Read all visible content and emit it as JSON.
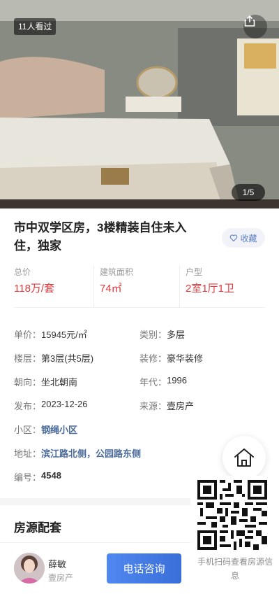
{
  "photo": {
    "viewed_badge": "11人看过",
    "counter": "1/5"
  },
  "listing": {
    "title": "市中双学区房，3楼精装自住未入住，独家",
    "favorite_label": "收藏"
  },
  "stats": [
    {
      "label": "总价",
      "value": "118万/套"
    },
    {
      "label": "建筑面积",
      "value": "74㎡"
    },
    {
      "label": "户型",
      "value": "2室1厅1卫"
    }
  ],
  "details": {
    "unit_price": {
      "key": "单价：",
      "value": "15945元/㎡"
    },
    "category": {
      "key": "类别：",
      "value": "多层"
    },
    "floor": {
      "key": "楼层：",
      "value": "第3层(共5层)"
    },
    "decoration": {
      "key": "装修：",
      "value": "豪华装修"
    },
    "orientation": {
      "key": "朝向：",
      "value": "坐北朝南"
    },
    "year": {
      "key": "年代：",
      "value": "1996"
    },
    "published": {
      "key": "发布：",
      "value": "2023-12-26"
    },
    "source": {
      "key": "来源：",
      "value": "壹房产"
    },
    "community": {
      "key": "小区：",
      "value": "钢绳小区"
    },
    "address": {
      "key": "地址：",
      "value": "滨江路北侧，公园路东侧"
    },
    "code": {
      "key": "编号：",
      "value": "4548"
    }
  },
  "facilities": {
    "title": "房源配套"
  },
  "qr": {
    "caption": "手机扫码查看房源信息"
  },
  "agent": {
    "name": "薛敏",
    "company": "壹房产",
    "call_label": "电话咨询"
  },
  "colors": {
    "price_red": "#e4393c",
    "link_blue": "#4a6b9a",
    "button_blue": "#3a6fd8"
  },
  "icons": {
    "share": "share-icon",
    "favorite": "heart-icon",
    "home": "home-icon"
  }
}
